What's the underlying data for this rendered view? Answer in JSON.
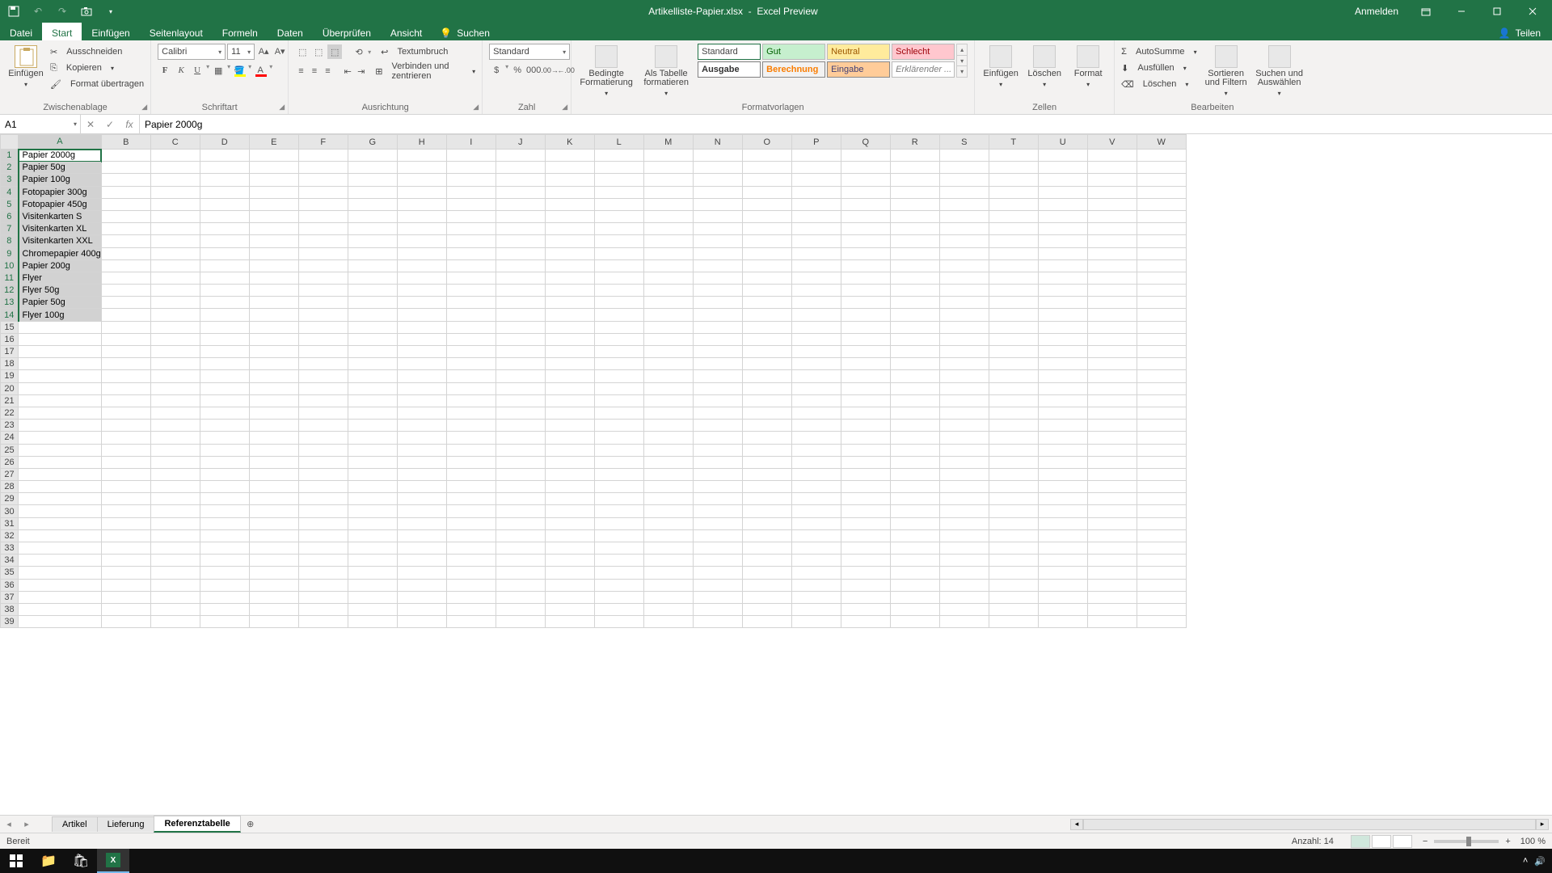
{
  "titlebar": {
    "filename": "Artikelliste-Papier.xlsx",
    "appname": "Excel Preview",
    "signin": "Anmelden"
  },
  "menu": {
    "file": "Datei",
    "tabs": [
      "Start",
      "Einfügen",
      "Seitenlayout",
      "Formeln",
      "Daten",
      "Überprüfen",
      "Ansicht"
    ],
    "active": "Start",
    "search": "Suchen",
    "share": "Teilen"
  },
  "ribbon": {
    "clipboard": {
      "label": "Zwischenablage",
      "paste": "Einfügen",
      "cut": "Ausschneiden",
      "copy": "Kopieren",
      "formatpainter": "Format übertragen"
    },
    "font": {
      "label": "Schriftart",
      "name": "Calibri",
      "size": "11"
    },
    "alignment": {
      "label": "Ausrichtung",
      "wrap": "Textumbruch",
      "merge": "Verbinden und zentrieren"
    },
    "number": {
      "label": "Zahl",
      "format": "Standard"
    },
    "styles": {
      "label": "Formatvorlagen",
      "condformat": "Bedingte Formatierung",
      "astable": "Als Tabelle formatieren",
      "row1": [
        "Standard",
        "Gut",
        "Neutral",
        "Schlecht"
      ],
      "row2": [
        "Ausgabe",
        "Berechnung",
        "Eingabe",
        "Erklärender ..."
      ]
    },
    "cells": {
      "label": "Zellen",
      "insert": "Einfügen",
      "delete": "Löschen",
      "format": "Format"
    },
    "editing": {
      "label": "Bearbeiten",
      "autosum": "AutoSumme",
      "fill": "Ausfüllen",
      "clear": "Löschen",
      "sort": "Sortieren und Filtern",
      "find": "Suchen und Auswählen"
    }
  },
  "namebox": "A1",
  "formula": "Papier 2000g",
  "columns": [
    "A",
    "B",
    "C",
    "D",
    "E",
    "F",
    "G",
    "H",
    "I",
    "J",
    "K",
    "L",
    "M",
    "N",
    "O",
    "P",
    "Q",
    "R",
    "S",
    "T",
    "U",
    "V",
    "W"
  ],
  "rows": 39,
  "selected_column": "A",
  "active_cell_row": 1,
  "data": {
    "A": [
      "Papier 2000g",
      "Papier 50g",
      "Papier 100g",
      "Fotopapier 300g",
      "Fotopapier 450g",
      "Visitenkarten S",
      "Visitenkarten XL",
      "Visitenkarten XXL",
      "Chromepapier 400g",
      "Papier 200g",
      "Flyer",
      "Flyer 50g",
      "Papier 50g",
      "Flyer 100g"
    ]
  },
  "sheets": {
    "tabs": [
      "Artikel",
      "Lieferung",
      "Referenztabelle"
    ],
    "active": "Referenztabelle"
  },
  "status": {
    "ready": "Bereit",
    "count_label": "Anzahl:",
    "count": "14",
    "zoom": "100 %"
  }
}
